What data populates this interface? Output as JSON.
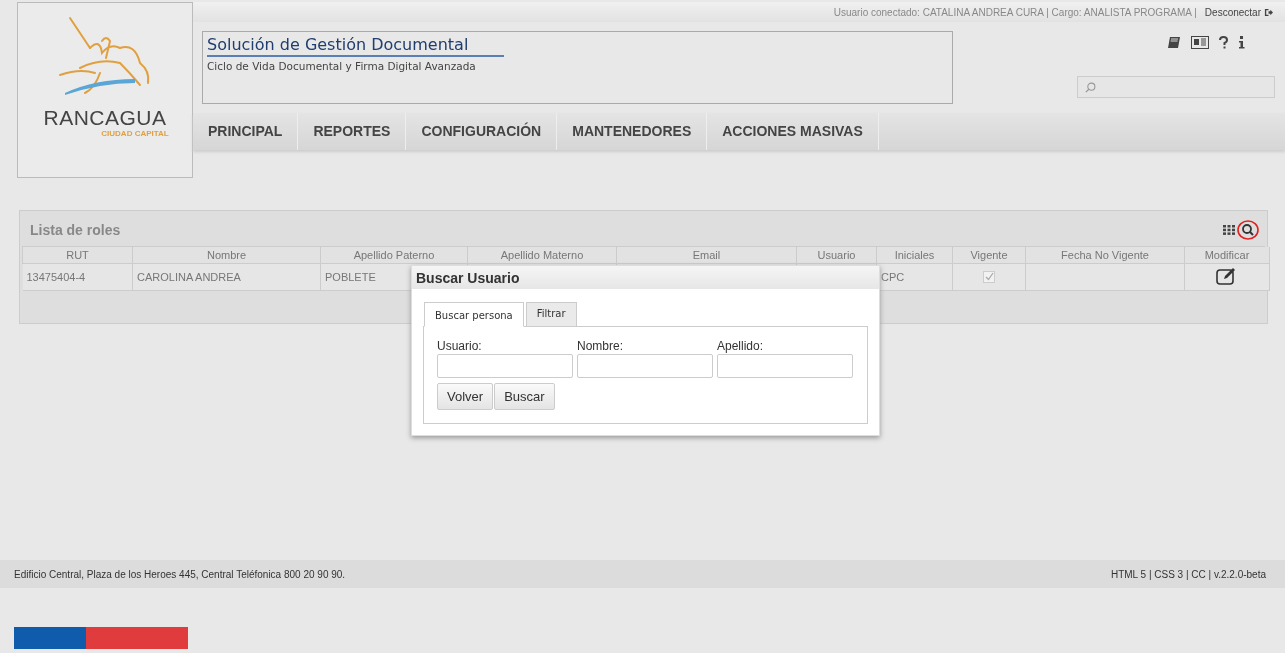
{
  "top_bar": {
    "user_info": "Usuario conectado: CATALINA ANDREA CURA | Cargo: ANALISTA PROGRAMA |",
    "logout": "Desconectar"
  },
  "logo": {
    "name": "RANCAGUA",
    "tagline": "CIUDAD CAPITAL"
  },
  "header": {
    "title": "Solución de Gestión Documental",
    "subtitle": "Ciclo de Vida Documental y Firma Digital Avanzada"
  },
  "header_icons": [
    {
      "kind": "book"
    },
    {
      "kind": "news"
    },
    {
      "kind": "help"
    },
    {
      "kind": "info"
    }
  ],
  "nav": [
    {
      "label": "PRINCIPAL"
    },
    {
      "label": "REPORTES"
    },
    {
      "label": "CONFIGURACIÓN"
    },
    {
      "label": "MANTENEDORES"
    },
    {
      "label": "ACCIONES MASIVAS"
    }
  ],
  "panel": {
    "title": "Lista de roles",
    "columns": [
      "RUT",
      "Nombre",
      "Apellido Paterno",
      "Apellido Materno",
      "Email",
      "Usuario",
      "Iniciales",
      "Vigente",
      "Fecha No Vigente",
      "Modificar"
    ],
    "rows": [
      {
        "rut": "13475404-4",
        "nombre": "CAROLINA ANDREA",
        "apellido_paterno": "POBLETE",
        "iniciales": "CPC",
        "vigente": true
      }
    ]
  },
  "dialog": {
    "title": "Buscar Usuario",
    "tabs": [
      {
        "label": "Buscar persona",
        "selected": true
      },
      {
        "label": "Filtrar",
        "selected": false
      }
    ],
    "fields": [
      {
        "label": "Usuario:"
      },
      {
        "label": "Nombre:"
      },
      {
        "label": "Apellido:"
      }
    ],
    "buttons": [
      "Volver",
      "Buscar"
    ]
  },
  "footer": {
    "address": "Edificio Central, Plaza de los Heroes 445, Central Teléfonica 800 20 90 90.",
    "version": "HTML 5 | CSS 3 | CC | v.2.2.0-beta"
  }
}
